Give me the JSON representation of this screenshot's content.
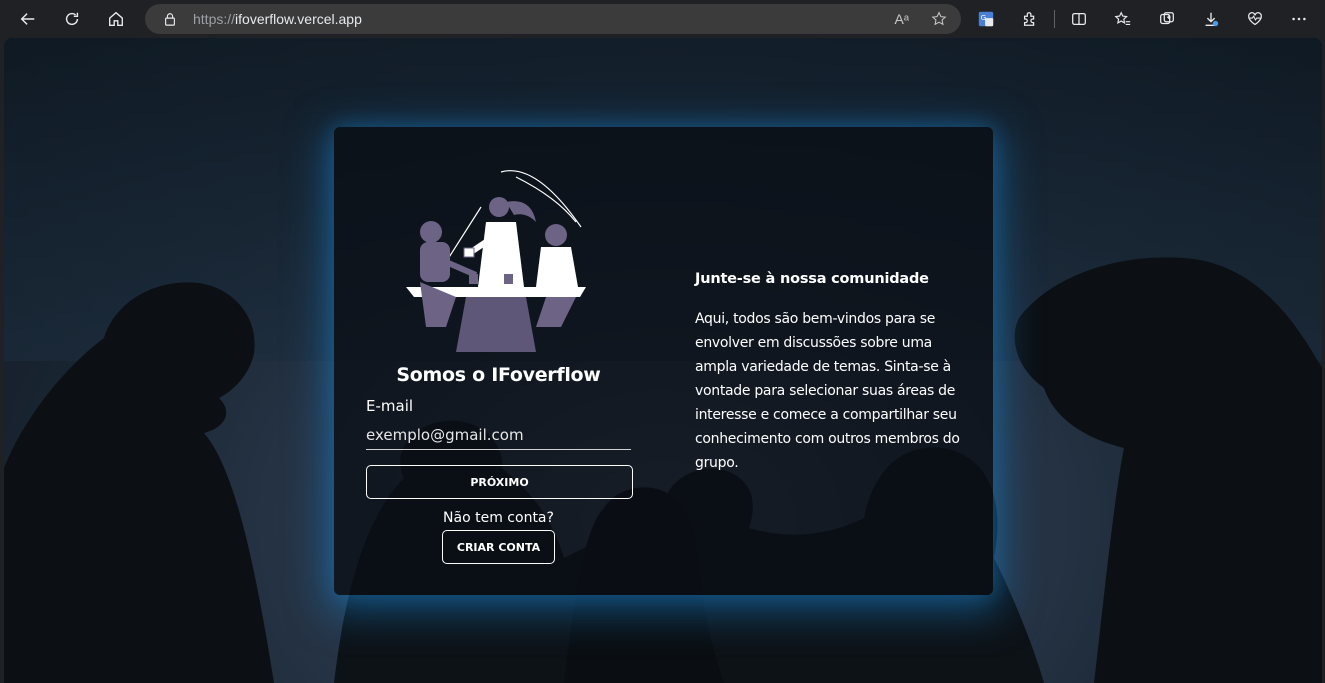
{
  "browser": {
    "url_protocol": "https://",
    "url_host": "ifoverflow.vercel.app",
    "read_aloud_label": "Aᵃ"
  },
  "login": {
    "brand_title": "Somos o IFoverflow",
    "email_label": "E-mail",
    "email_placeholder": "exemplo@gmail.com",
    "next_button": "PRÓXIMO",
    "no_account_text": "Não tem conta?",
    "create_account_button": "CRIAR CONTA"
  },
  "community": {
    "title": "Junte-se à nossa comunidade",
    "body": "Aqui, todos são bem-vindos para se envolver em discussões sobre uma ampla variedade de temas. Sinta-se à vontade para selecionar suas áreas de interesse e comece a compartilhar seu conhecimento com outros membros do grupo."
  },
  "colors": {
    "card_glow": "#1978be",
    "illustration_purple": "#6c6385",
    "text": "#ffffff"
  }
}
